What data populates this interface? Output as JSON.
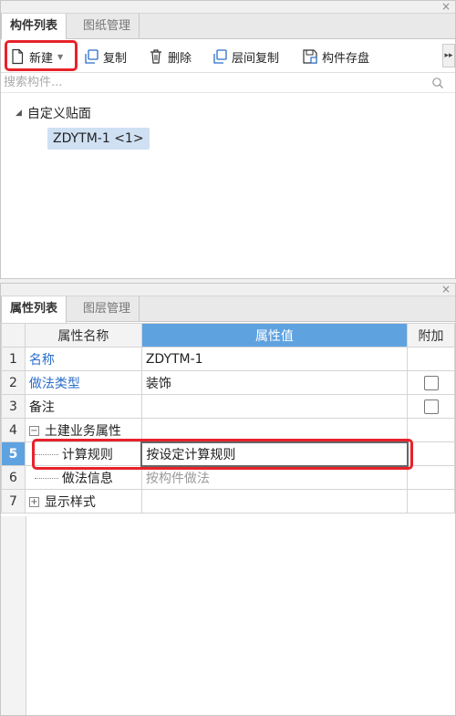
{
  "top_panel": {
    "close_symbol": "×",
    "tabs": [
      {
        "label": "构件列表",
        "active": true
      },
      {
        "label": "图纸管理",
        "active": false
      }
    ],
    "toolbar": {
      "new_label": "新建",
      "copy_label": "复制",
      "delete_label": "删除",
      "floor_copy_label": "层间复制",
      "save_label": "构件存盘",
      "overflow_symbol": "▸▸"
    },
    "search": {
      "placeholder": "搜索构件..."
    },
    "tree": {
      "root_label": "自定义贴面",
      "leaf_label": "ZDYTM-1 <1>"
    }
  },
  "bottom_panel": {
    "close_symbol": "×",
    "tabs": [
      {
        "label": "属性列表",
        "active": true
      },
      {
        "label": "图层管理",
        "active": false
      }
    ],
    "columns": [
      "属性名称",
      "属性值",
      "附加"
    ],
    "rows": [
      {
        "num": "1",
        "name": "名称",
        "value": "ZDYTM-1",
        "link": true,
        "checkbox": false
      },
      {
        "num": "2",
        "name": "做法类型",
        "value": "装饰",
        "link": true,
        "checkbox": true
      },
      {
        "num": "3",
        "name": "备注",
        "value": "",
        "link": false,
        "checkbox": true
      },
      {
        "num": "4",
        "name": "土建业务属性",
        "value": "",
        "link": false,
        "checkbox": false
      },
      {
        "num": "5",
        "name": "计算规则",
        "value": "按设定计算规则",
        "link": false,
        "checkbox": false
      },
      {
        "num": "6",
        "name": "做法信息",
        "value": "按构件做法",
        "link": false,
        "checkbox": false
      },
      {
        "num": "7",
        "name": "显示样式",
        "value": "",
        "link": false,
        "checkbox": false
      }
    ],
    "expander_minus": "−",
    "expander_plus": "+"
  },
  "colors": {
    "highlight_red": "#e8222a",
    "selection_blue": "#5fa2e0",
    "tree_selection": "#cfe0f3",
    "link_blue": "#2a6ecb"
  }
}
